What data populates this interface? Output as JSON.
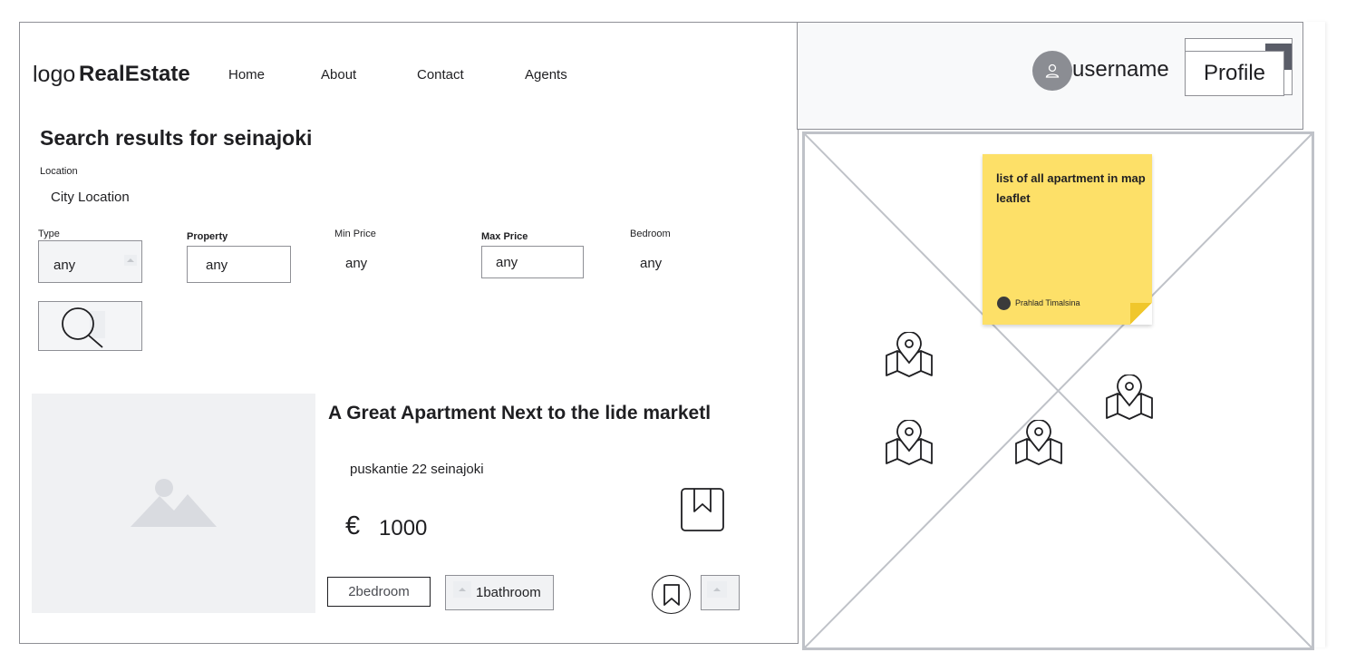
{
  "header": {
    "logo_prefix": "logo",
    "logo_brand": "RealEstate",
    "nav": [
      {
        "label": "Home"
      },
      {
        "label": "About"
      },
      {
        "label": "Contact"
      },
      {
        "label": "Agents"
      }
    ],
    "username": "username",
    "profile_label": "Profile"
  },
  "search": {
    "title": "Search results for seinajoki",
    "location_label": "Location",
    "location_value": "City Location",
    "type_label": "Type",
    "type_value": "any",
    "property_label": "Property",
    "property_value": "any",
    "min_price_label": "Min Price",
    "min_price_value": "any",
    "max_price_label": "Max Price",
    "max_price_value": "any",
    "bedroom_label": "Bedroom",
    "bedroom_value": "any",
    "button_icon": "search-icon"
  },
  "listing": {
    "title": "A Great Apartment Next to the lide marketl",
    "address": "puskantie 22  seinajoki",
    "currency": "€",
    "price": "1000",
    "bedrooms": "2bedroom",
    "bathrooms": "1bathroom",
    "image_icon": "image-placeholder-icon"
  },
  "map": {
    "note_text": "list of all apartment in map leaflet",
    "note_author": "Prahlad Timalsina",
    "markers": [
      "map-pin-icon",
      "map-pin-icon",
      "map-pin-icon",
      "map-pin-icon"
    ]
  },
  "colors": {
    "border": "#8f9096",
    "sticky": "#fde068",
    "placeholder": "#f0f1f3",
    "avatar": "#8b8d93"
  }
}
